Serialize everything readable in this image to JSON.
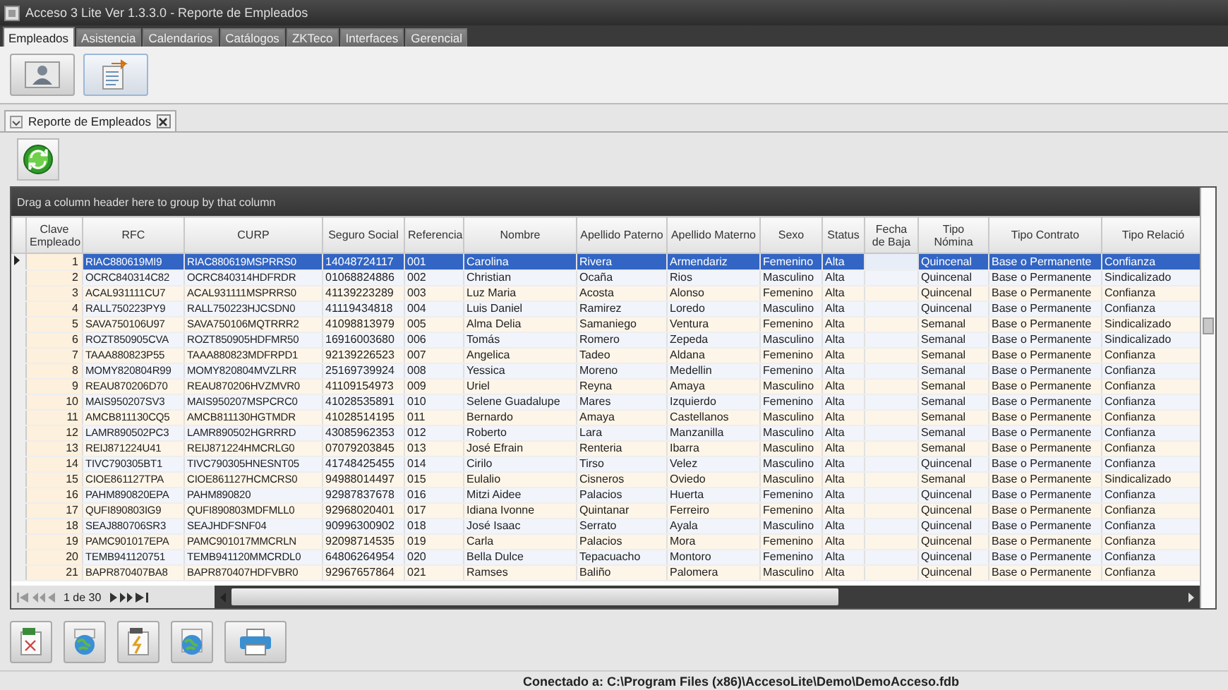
{
  "window": {
    "title": "Acceso 3 Lite Ver 1.3.3.0 - Reporte de Empleados"
  },
  "tabs": [
    {
      "label": "Empleados",
      "selected": true
    },
    {
      "label": "Asistencia",
      "selected": false
    },
    {
      "label": "Calendarios",
      "selected": false
    },
    {
      "label": "Catálogos",
      "selected": false
    },
    {
      "label": "ZKTeco",
      "selected": false
    },
    {
      "label": "Interfaces",
      "selected": false
    },
    {
      "label": "Gerencial",
      "selected": false
    }
  ],
  "toolbar": [
    {
      "kind": "employees",
      "selected": false
    },
    {
      "kind": "report",
      "selected": true
    }
  ],
  "document_tabs": [
    {
      "label": "Reporte de Empleados",
      "selected": true
    }
  ],
  "actions": [
    {
      "kind": "refresh"
    }
  ],
  "grid": {
    "group_panel": "Drag a column header here to group by that column",
    "columns": [
      "Clave Empleado",
      "RFC",
      "CURP",
      "Seguro Social",
      "Referencia",
      "Nombre",
      "Apellido Paterno",
      "Apellido Materno",
      "Sexo",
      "Status",
      "Fecha de Baja",
      "Tipo Nómina",
      "Tipo Contrato",
      "Tipo Relació"
    ],
    "rows": [
      {
        "selected": true,
        "cells": [
          "1",
          "RIAC880619MI9",
          "RIAC880619MSPRRS0",
          "14048724117",
          "001",
          "Carolina",
          "Rivera",
          "Armendariz",
          "Femenino",
          "Alta",
          null,
          "Quincenal",
          "Base o Permanente",
          "Confianza"
        ]
      },
      {
        "selected": false,
        "cells": [
          "2",
          "OCRC840314C82",
          "OCRC840314HDFRDR",
          "01068824886",
          "002",
          "Christian",
          "Ocaña",
          "Rios",
          "Masculino",
          "Alta",
          null,
          "Quincenal",
          "Base o Permanente",
          "Sindicalizado"
        ]
      },
      {
        "selected": false,
        "cells": [
          "3",
          "ACAL931111CU7",
          "ACAL931111MSPRRS0",
          "41139223289",
          "003",
          "Luz Maria",
          "Acosta",
          "Alonso",
          "Femenino",
          "Alta",
          null,
          "Quincenal",
          "Base o Permanente",
          "Confianza"
        ]
      },
      {
        "selected": false,
        "cells": [
          "4",
          "RALL750223PY9",
          "RALL750223HJCSDN0",
          "41119434818",
          "004",
          "Luis Daniel",
          "Ramirez",
          "Loredo",
          "Masculino",
          "Alta",
          null,
          "Quincenal",
          "Base o Permanente",
          "Confianza"
        ]
      },
      {
        "selected": false,
        "cells": [
          "5",
          "SAVA750106U97",
          "SAVA750106MQTRRR2",
          "41098813979",
          "005",
          "Alma Delia",
          "Samaniego",
          "Ventura",
          "Femenino",
          "Alta",
          null,
          "Semanal",
          "Base o Permanente",
          "Sindicalizado"
        ]
      },
      {
        "selected": false,
        "cells": [
          "6",
          "ROZT850905CVA",
          "ROZT850905HDFMR50",
          "16916003680",
          "006",
          "Tomás",
          "Romero",
          "Zepeda",
          "Masculino",
          "Alta",
          null,
          "Semanal",
          "Base o Permanente",
          "Sindicalizado"
        ]
      },
      {
        "selected": false,
        "cells": [
          "7",
          "TAAA880823P55",
          "TAAA880823MDFRPD1",
          "92139226523",
          "007",
          "Angelica",
          "Tadeo",
          "Aldana",
          "Femenino",
          "Alta",
          null,
          "Semanal",
          "Base o Permanente",
          "Confianza"
        ]
      },
      {
        "selected": false,
        "cells": [
          "8",
          "MOMY820804R99",
          "MOMY820804MVZLRR",
          "25169739924",
          "008",
          "Yessica",
          "Moreno",
          "Medellin",
          "Femenino",
          "Alta",
          null,
          "Semanal",
          "Base o Permanente",
          "Confianza"
        ]
      },
      {
        "selected": false,
        "cells": [
          "9",
          "REAU870206D70",
          "REAU870206HVZMVR0",
          "41109154973",
          "009",
          "Uriel",
          "Reyna",
          "Amaya",
          "Masculino",
          "Alta",
          null,
          "Semanal",
          "Base o Permanente",
          "Confianza"
        ]
      },
      {
        "selected": false,
        "cells": [
          "10",
          "MAIS950207SV3",
          "MAIS950207MSPCRC0",
          "41028535891",
          "010",
          "Selene Guadalupe",
          "Mares",
          "Izquierdo",
          "Femenino",
          "Alta",
          null,
          "Semanal",
          "Base o Permanente",
          "Confianza"
        ]
      },
      {
        "selected": false,
        "cells": [
          "11",
          "AMCB811130CQ5",
          "AMCB811130HGTMDR",
          "41028514195",
          "011",
          "Bernardo",
          "Amaya",
          "Castellanos",
          "Masculino",
          "Alta",
          null,
          "Semanal",
          "Base o Permanente",
          "Confianza"
        ]
      },
      {
        "selected": false,
        "cells": [
          "12",
          "LAMR890502PC3",
          "LAMR890502HGRRRD",
          "43085962353",
          "012",
          "Roberto",
          "Lara",
          "Manzanilla",
          "Masculino",
          "Alta",
          null,
          "Semanal",
          "Base o Permanente",
          "Confianza"
        ]
      },
      {
        "selected": false,
        "cells": [
          "13",
          "REIJ871224U41",
          "REIJ871224HMCRLG0",
          "07079203845",
          "013",
          "José Efrain",
          "Renteria",
          "Ibarra",
          "Masculino",
          "Alta",
          null,
          "Semanal",
          "Base o Permanente",
          "Confianza"
        ]
      },
      {
        "selected": false,
        "cells": [
          "14",
          "TIVC790305BT1",
          "TIVC790305HNESNT05",
          "41748425455",
          "014",
          "Cirilo",
          "Tirso",
          "Velez",
          "Masculino",
          "Alta",
          null,
          "Quincenal",
          "Base o Permanente",
          "Confianza"
        ]
      },
      {
        "selected": false,
        "cells": [
          "15",
          "CIOE861127TPA",
          "CIOE861127HCMCRS0",
          "94988014497",
          "015",
          "Eulalio",
          "Cisneros",
          "Oviedo",
          "Masculino",
          "Alta",
          null,
          "Semanal",
          "Base o Permanente",
          "Sindicalizado"
        ]
      },
      {
        "selected": false,
        "cells": [
          "16",
          "PAHM890820EPA",
          "PAHM890820",
          "92987837678",
          "016",
          "Mitzi Aidee",
          "Palacios",
          "Huerta",
          "Femenino",
          "Alta",
          null,
          "Quincenal",
          "Base o Permanente",
          "Confianza"
        ]
      },
      {
        "selected": false,
        "cells": [
          "17",
          "QUFI890803IG9",
          "QUFI890803MDFMLL0",
          "92968020401",
          "017",
          "Idiana Ivonne",
          "Quintanar",
          "Ferreiro",
          "Femenino",
          "Alta",
          null,
          "Quincenal",
          "Base o Permanente",
          "Confianza"
        ]
      },
      {
        "selected": false,
        "cells": [
          "18",
          "SEAJ880706SR3",
          "SEAJHDFSNF04",
          "90996300902",
          "018",
          "José Isaac",
          "Serrato",
          "Ayala",
          "Masculino",
          "Alta",
          null,
          "Quincenal",
          "Base o Permanente",
          "Confianza"
        ]
      },
      {
        "selected": false,
        "cells": [
          "19",
          "PAMC901017EPA",
          "PAMC901017MMCRLN",
          "92098714535",
          "019",
          "Carla",
          "Palacios",
          "Mora",
          "Femenino",
          "Alta",
          null,
          "Quincenal",
          "Base o Permanente",
          "Confianza"
        ]
      },
      {
        "selected": false,
        "cells": [
          "20",
          "TEMB941120751",
          "TEMB941120MMCRDL0",
          "64806264954",
          "020",
          "Bella Dulce",
          "Tepacuacho",
          "Montoro",
          "Femenino",
          "Alta",
          null,
          "Quincenal",
          "Base o Permanente",
          "Confianza"
        ]
      },
      {
        "selected": false,
        "cells": [
          "21",
          "BAPR870407BA8",
          "BAPR870407HDFVBR0",
          "92967657864",
          "021",
          "Ramses",
          "Baliño",
          "Palomera",
          "Masculino",
          "Alta",
          null,
          "Quincenal",
          "Base o Permanente",
          "Confianza"
        ]
      }
    ],
    "pager": {
      "page": "1 de 30"
    }
  },
  "export_buttons": [
    {
      "kind": "spreadsheet"
    },
    {
      "kind": "web"
    },
    {
      "kind": "document"
    },
    {
      "kind": "globe"
    },
    {
      "kind": "print"
    }
  ],
  "status_bar": "Conectado a: C:\\Program Files (x86)\\AccesoLite\\Demo\\DemoAcceso.fdb"
}
